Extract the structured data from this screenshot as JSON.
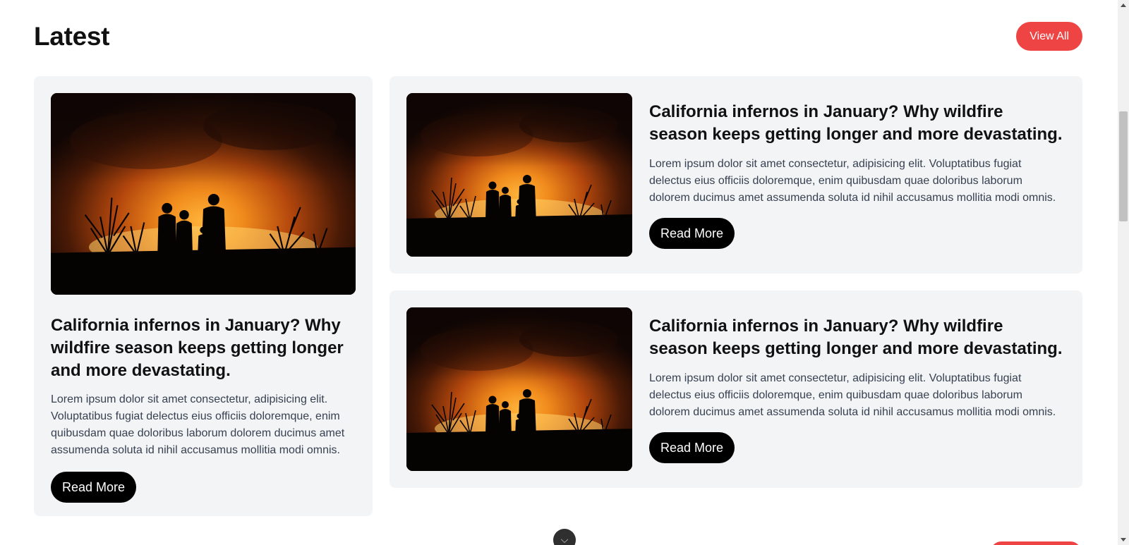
{
  "section": {
    "title": "Latest",
    "view_all_label": "View All",
    "accent_color": "#ef4444"
  },
  "articles": [
    {
      "image_icon": "wildfire-silhouettes-photo",
      "title": "California infernos in January? Why wildfire season keeps getting longer and more devastating.",
      "excerpt": "Lorem ipsum dolor sit amet consectetur, adipisicing elit. Voluptatibus fugiat delectus eius officiis doloremque, enim quibusdam quae doloribus laborum dolorem ducimus amet assumenda soluta id nihil accusamus mollitia modi omnis.",
      "read_more_label": "Read More"
    },
    {
      "image_icon": "wildfire-silhouettes-photo",
      "title": "California infernos in January? Why wildfire season keeps getting longer and more devastating.",
      "excerpt": "Lorem ipsum dolor sit amet consectetur, adipisicing elit. Voluptatibus fugiat delectus eius officiis doloremque, enim quibusdam quae doloribus laborum dolorem ducimus amet assumenda soluta id nihil accusamus mollitia modi omnis.",
      "read_more_label": "Read More"
    },
    {
      "image_icon": "wildfire-silhouettes-photo",
      "title": "California infernos in January? Why wildfire season keeps getting longer and more devastating.",
      "excerpt": "Lorem ipsum dolor sit amet consectetur, adipisicing elit. Voluptatibus fugiat delectus eius officiis doloremque, enim quibusdam quae doloribus laborum dolorem ducimus amet assumenda soluta id nihil accusamus mollitia modi omnis.",
      "read_more_label": "Read More"
    }
  ],
  "scroll_top": {
    "icon": "chevron-down-icon"
  }
}
